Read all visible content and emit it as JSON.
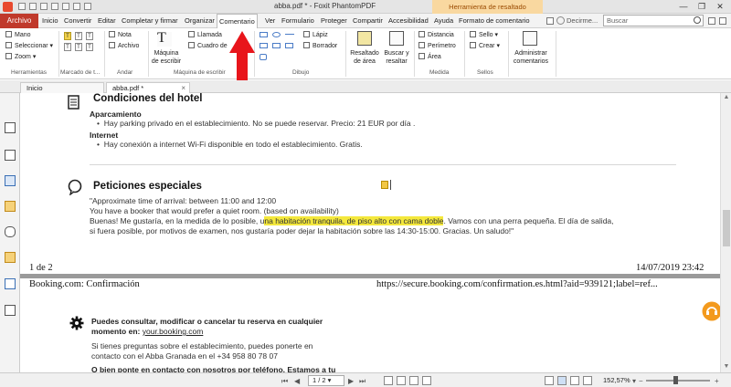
{
  "window": {
    "title": "abba.pdf * - Foxit PhantomPDF",
    "context_tab": "Herramienta de resaltado",
    "controls": [
      "—",
      "❐",
      "✕"
    ]
  },
  "menu": {
    "file": "Archivo",
    "items": [
      "Inicio",
      "Convertir",
      "Editar",
      "Completar y firmar",
      "Organizar",
      "Comentario",
      "Ver",
      "Formulario",
      "Proteger",
      "Compartir",
      "Accesibilidad",
      "Ayuda",
      "Formato de comentario"
    ],
    "active": "Comentario",
    "help_link": "Decirme...",
    "search_placeholder": "Buscar"
  },
  "ribbon": {
    "herramientas": {
      "items": [
        "Mano",
        "Seleccionar",
        "Zoom"
      ],
      "label": "Herramientas"
    },
    "marcado": {
      "label": "Marcado de t..."
    },
    "andar": {
      "items": [
        "Nota",
        "Archivo"
      ],
      "label": "Andar"
    },
    "maquina": {
      "big": "Máquina de escribir",
      "items": [
        "Llamada",
        "Cuadro de"
      ],
      "label": "Máquina de escribir"
    },
    "dibujo": {
      "items": [
        "Lápiz",
        "Borrador"
      ],
      "label": "Dibujo"
    },
    "resaltado": {
      "big1": "Resaltado de área",
      "big2": "Buscar y resaltar"
    },
    "medida": {
      "items": [
        "Distancia",
        "Perímetro",
        "Área"
      ],
      "label": "Medida"
    },
    "sellos": {
      "items": [
        "Sello",
        "Crear"
      ],
      "label": "Sellos"
    },
    "administrar": {
      "label": "Administrar comentarios"
    }
  },
  "tabs": [
    {
      "label": "Inicio"
    },
    {
      "label": "abba.pdf *",
      "close": "×"
    }
  ],
  "doc": {
    "hotel_title": "Condiciones del hotel",
    "parking_head": "Aparcamiento",
    "parking_text": "Hay parking privado en el establecimiento. No se puede reservar. Precio: 21 EUR por día .",
    "internet_head": "Internet",
    "internet_text": "Hay conexión a internet Wi-Fi disponible en todo el establecimiento. Gratis.",
    "requests_title": "Peticiones especiales",
    "req_line1": "\"Approximate time of arrival: between 11:00 and 12:00",
    "req_line2": "You have a booker that would prefer a quiet room. (based on availability)",
    "req_line3_pre": "Buenas! Me gustaría, en la medida de lo posible, u",
    "req_line3_hl": "na habitación tranquila, de piso alto con cama doble",
    "req_line3_post": ". Vamos con una perra pequeña. El día de salida,",
    "req_line4": "si fuera posible, por motivos de examen, nos gustaría poder dejar la habitación sobre las 14:30-15:00. Gracias. Un saludo!\"",
    "page_footer_left": "1 de 2",
    "page_footer_right": "14/07/2019 23:42",
    "header2_left": "Booking.com: Confirmación",
    "header2_right": "https://secure.booking.com/confirmation.es.html?aid=939121;label=ref...",
    "gear_line1": "Puedes consultar, modificar o cancelar tu reserva en cualquier",
    "gear_line2_pre": "momento en: ",
    "gear_link": "your.booking.com",
    "contact1": "Si tienes preguntas sobre el establecimiento, puedes ponerte en",
    "contact2": "contacto con el Abba Granada en el +34 958 80 78 07",
    "contact3": "O bien ponte en contacto con nosotros por teléfono. Estamos a tu"
  },
  "status": {
    "page_field": "1 / 2",
    "zoom": "152,57%",
    "zoom_level": 0.45
  }
}
